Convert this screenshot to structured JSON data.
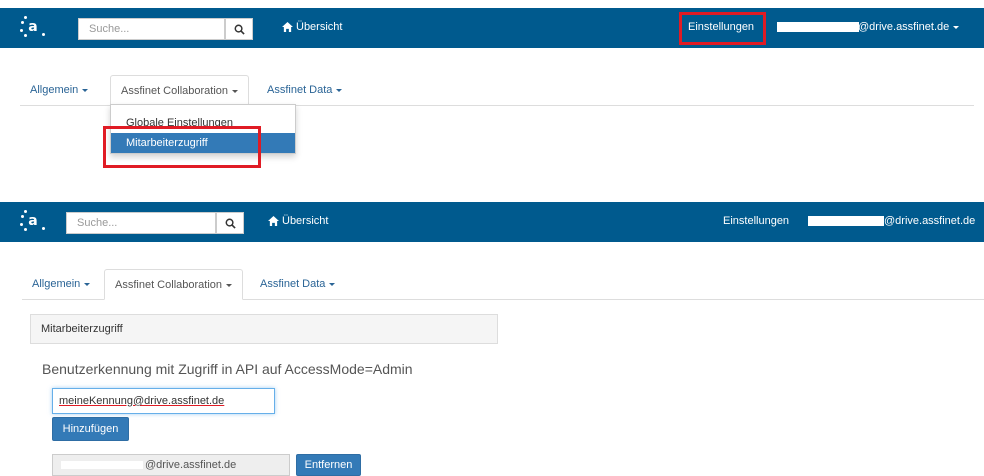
{
  "top": {
    "navbar": {
      "search_placeholder": "Suche...",
      "home_label": "Übersicht",
      "settings_label": "Einstellungen",
      "account_suffix": "@drive.assfinet.de"
    },
    "tabs": [
      "Allgemein",
      "Assfinet Collaboration",
      "Assfinet Data"
    ],
    "dropdown_items": [
      "Globale Einstellungen",
      "Mitarbeiterzugriff"
    ]
  },
  "bottom": {
    "navbar": {
      "search_placeholder": "Suche...",
      "home_label": "Übersicht",
      "settings_label": "Einstellungen",
      "account_suffix": "@drive.assfinet.de"
    },
    "tabs": [
      "Allgemein",
      "Assfinet Collaboration",
      "Assfinet Data"
    ],
    "panel_title": "Mitarbeiterzugriff",
    "section_title": "Benutzerkennung mit Zugriff in API auf AccessMode=Admin",
    "input_value_user": "meineKennung",
    "input_value_domain": "@drive.assfinet.de",
    "add_button": "Hinzufügen",
    "existing_entry_suffix": "@drive.assfinet.de",
    "remove_button": "Entfernen"
  },
  "colors": {
    "navbar": "#005a8e",
    "highlight": "#e01b24",
    "primary": "#337ab7"
  },
  "icons": {
    "search": "search-icon",
    "home": "home-icon",
    "logo": "assfinet-logo-icon"
  }
}
